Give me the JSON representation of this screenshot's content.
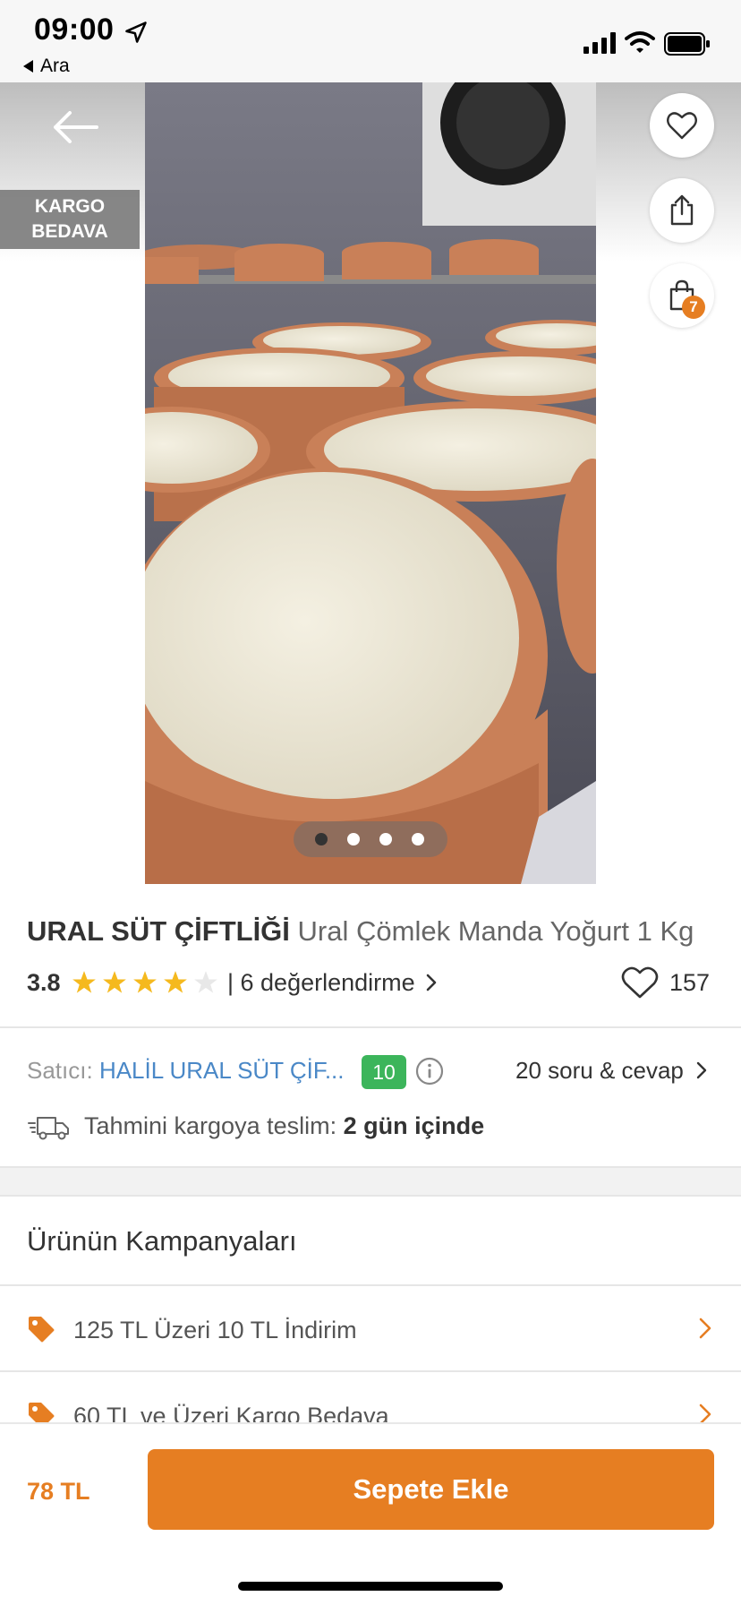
{
  "status_bar": {
    "time": "09:00",
    "back_app": "Ara"
  },
  "hero": {
    "badge_line1": "KARGO",
    "badge_line2": "BEDAVA",
    "cart_count": "7",
    "image_count": 4,
    "active_image": 1
  },
  "product": {
    "brand": "URAL SÜT ÇİFTLİĞİ",
    "name": "Ural Çömlek Manda Yoğurt 1 Kg",
    "rating": "3.8",
    "stars": 4,
    "reviews_label": "| 6 değerlendirme",
    "favorites": "157"
  },
  "seller": {
    "label": "Satıcı:",
    "name": "HALİL URAL SÜT ÇİF...",
    "score": "10",
    "qa_label": "20 soru & cevap",
    "delivery_label": "Tahmini kargoya teslim:",
    "delivery_value": "2 gün içinde"
  },
  "campaigns": {
    "title": "Ürünün Kampanyaları",
    "items": [
      {
        "label": "125 TL Üzeri 10 TL İndirim"
      },
      {
        "label": "60 TL ve Üzeri Kargo Bedava"
      }
    ]
  },
  "bottom": {
    "price": "78 TL",
    "add_to_cart": "Sepete Ekle"
  },
  "colors": {
    "accent": "#e67e22",
    "seller_link": "#4a88c7",
    "score_badge": "#3cb55b",
    "star_filled": "#f5b91e",
    "star_empty": "#e8e8e8"
  },
  "icons": [
    "location-arrow-icon",
    "signal-icon",
    "wifi-icon",
    "battery-icon",
    "back-arrow-icon",
    "heart-icon",
    "share-icon",
    "bag-icon",
    "star-icon",
    "chevron-right-icon",
    "info-icon",
    "truck-icon",
    "tag-icon"
  ]
}
